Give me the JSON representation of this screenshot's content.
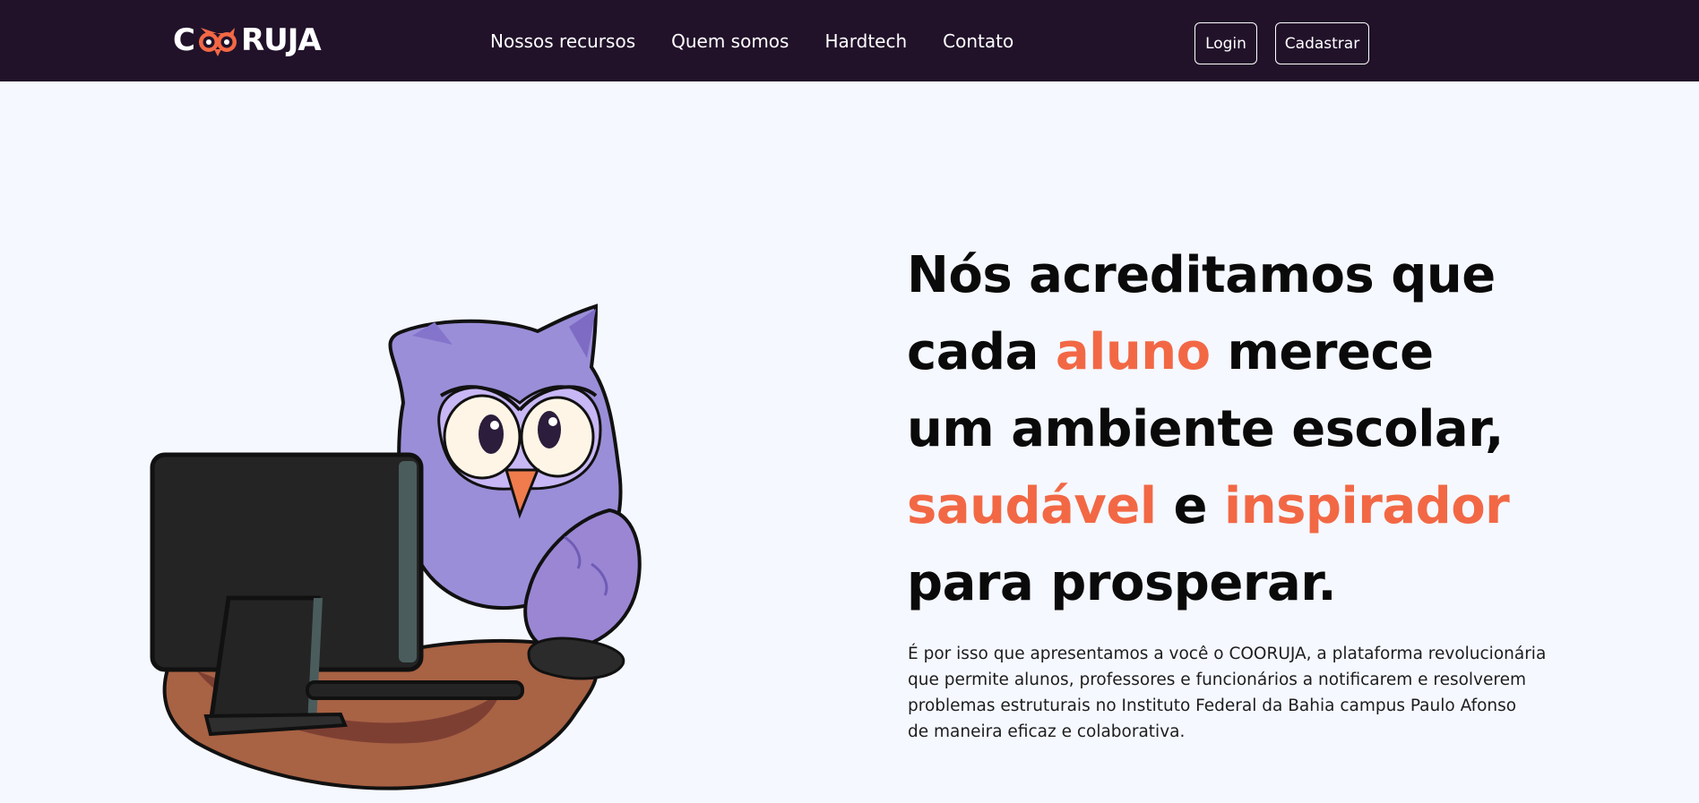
{
  "brand": {
    "logo_prefix": "C",
    "logo_suffix": "RUJA",
    "logo_alt": "COORUJA",
    "colors": {
      "nav_bg": "#21122a",
      "accent": "#f26845",
      "page_bg": "#f5f8ff"
    }
  },
  "nav": {
    "links": [
      "Nossos recursos",
      "Quem somos",
      "Hardtech",
      "Contato"
    ],
    "login_label": "Login",
    "signup_label": "Cadastrar"
  },
  "hero": {
    "headline": {
      "l1": "Nós acreditamos que",
      "l2a": "cada ",
      "l2b": "aluno",
      "l2c": " merece",
      "l3": "um ambiente escolar,",
      "l4a": "saudável",
      "l4b": " e ",
      "l4c": "inspirador",
      "l5": "para prosperar."
    },
    "description": [
      "É por isso que apresentamos a você o COORUJA, a plataforma revolucionária",
      "que permite alunos, professores e funcionários a notificarem e resolverem",
      "problemas estruturais no Instituto Federal da Bahia campus Paulo Afonso",
      "de maneira eficaz e colaborativa."
    ],
    "illustration_icon": "owl-at-computer-illustration"
  }
}
